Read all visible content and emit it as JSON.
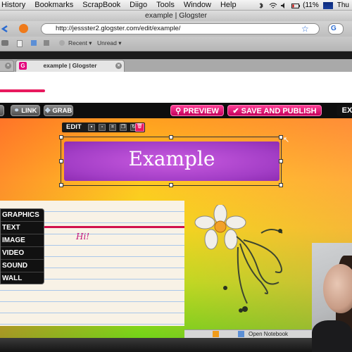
{
  "menubar": {
    "items": [
      "History",
      "Bookmarks",
      "ScrapBook",
      "Diigo",
      "Tools",
      "Window",
      "Help"
    ],
    "battery": "(11%",
    "clock": "Thu"
  },
  "window": {
    "title": "example | Glogster"
  },
  "nav": {
    "url": "http://jessster2.glogster.com/edit/example/"
  },
  "bookmarks": {
    "recent": "Recent ▾",
    "unread": "Unread ▾"
  },
  "tabs": [
    {
      "label": "example | Glogster"
    }
  ],
  "glogster": {
    "link": "LINK",
    "grab": "GRAB",
    "preview": "PREVIEW",
    "save_publish": "SAVE AND PUBLISH",
    "exit": "EX"
  },
  "editor": {
    "edit_label": "EDIT",
    "title_text": "Example",
    "categories": [
      "GRAPHICS",
      "TEXT",
      "IMAGE",
      "VIDEO",
      "SOUND",
      "WALL"
    ],
    "note_text": "Hi!"
  },
  "statusbar": {
    "open_notebook": "Open Notebook"
  },
  "colors": {
    "accent": "#e8195e",
    "title_purple": "#a33ec6",
    "button_pink": "#ff3f96"
  }
}
